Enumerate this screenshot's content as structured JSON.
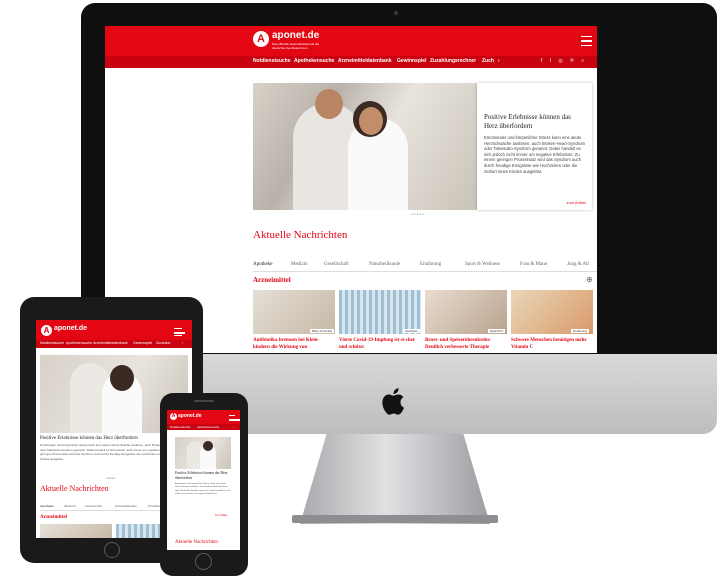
{
  "brand": {
    "name": "aponet.de",
    "logo_letter": "A",
    "tagline": "Das offizielle Gesundheitsportal der deutschen Apothekerinnen",
    "color": "#e30613"
  },
  "nav": {
    "items": [
      "Notdienstsuche",
      "Apothekensuche",
      "Arzneimitteldatenbank",
      "Gewinnspiel",
      "Zuzahlungsrechner",
      "Zuch"
    ],
    "more": "›",
    "icons": [
      "facebook-icon",
      "twitter-icon",
      "instagram-icon",
      "pinterest-icon",
      "search-icon"
    ],
    "icon_glyphs": "f  t  ◎  ℗  ⌕"
  },
  "hero": {
    "title": "Positive Erlebnisse können das Herz überfordern",
    "body": "Emotionaler und körperlicher Stress kann eine akute Herzschwäche auslösen, auch Broken-Heart-Syndrom oder Takotsubo-Syndrom genannt. Dabei handelt es sich jedoch nicht immer um negative Erlebnisse: Zu einem geringen Prozentsatz wird das Syndrom auch durch freudige Ereignisse wie Hochzeiten oder die Geburt eines Kindes ausgelöst.",
    "more": "zum Artikel",
    "dots": "●●●●●"
  },
  "news": {
    "title": "Aktuelle Nachrichten",
    "tabs": [
      "Apotheke",
      "Medizin",
      "Gesellschaft",
      "Naturheilkunde",
      "Ernährung",
      "Sport & Wellness",
      "Frau & Mann",
      "Jung & Alt"
    ],
    "category": "Arzneimittel",
    "category_icon": "⊕",
    "cards": [
      {
        "title": "Antibiotika bremsen bei Klein-kindern die Wirkung von",
        "tag": "Baby & Familie"
      },
      {
        "title": "Vierte Covid-19-Impfung ist si-cher und schützt",
        "tag": "Apotheke"
      },
      {
        "title": "Brust- und Speiseröhrenkrebs: Deutlich verbesserte Therapie",
        "tag": "Nachricht"
      },
      {
        "title": "Schwere Menschen benötigen mehr Vitamin C",
        "tag": "Ernährung"
      }
    ]
  },
  "tablet": {
    "nav_items": [
      "Notdienstsuche",
      "Apothekensuche",
      "Arzneimitteldatenbank",
      "Gewinnspiel",
      "Zuzahlun",
      "›"
    ],
    "hero_title": "Positive Erlebnisse können das Herz überfordern",
    "hero_body": "Emotionaler und körperlicher Stress kann eine akute Herzschwäche auslösen, auch Broken-Heart-Syndrom oder Takotsubo-Syndrom genannt. Dabei handelt es sich jedoch nicht immer um negative Erlebnisse: Zu einem geringen Prozentsatz wird das Syndrom auch durch freudige Ereignisse wie Hochzeiten oder die Geburt eines Kindes ausgelöst.",
    "tabs": [
      "Apotheke",
      "Medizin",
      "Gesellschaft",
      "Naturheilkunde",
      "Ernährung",
      "Sp"
    ]
  },
  "phone": {
    "nav_items": [
      "Notdienstsuche",
      "Apothekensuche",
      "›"
    ],
    "hero_title": "Positive Erlebnisse können das Herz überfordern",
    "hero_body": "Emotionaler und körperlicher Stress kann eine akute Herzschwäche auslösen, auch Broken-Heart-Syndrom oder Takotsubo-Syndrom genannt. Dabei handelt es sich jedoch nicht immer um negative Erlebnisse.",
    "more": "zum Artikel"
  }
}
